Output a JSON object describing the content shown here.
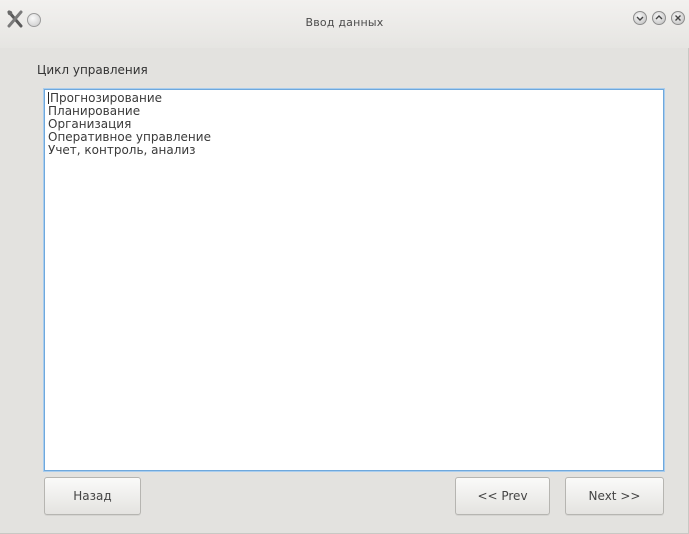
{
  "window": {
    "title": "Ввод данных"
  },
  "content": {
    "section_label": "Цикл управления",
    "lines": [
      "Прогнозирование",
      "Планирование",
      "Организация",
      "Оперативное управление",
      "Учет, контроль, анализ"
    ]
  },
  "buttons": {
    "back": "Назад",
    "prev": "<< Prev",
    "next": "Next >>"
  },
  "icons": {
    "app": "tools-icon",
    "pin": "pin-icon",
    "minimize": "minimize-icon",
    "maximize": "maximize-icon",
    "close": "close-icon"
  },
  "colors": {
    "focus_border": "#6fa8dc"
  }
}
